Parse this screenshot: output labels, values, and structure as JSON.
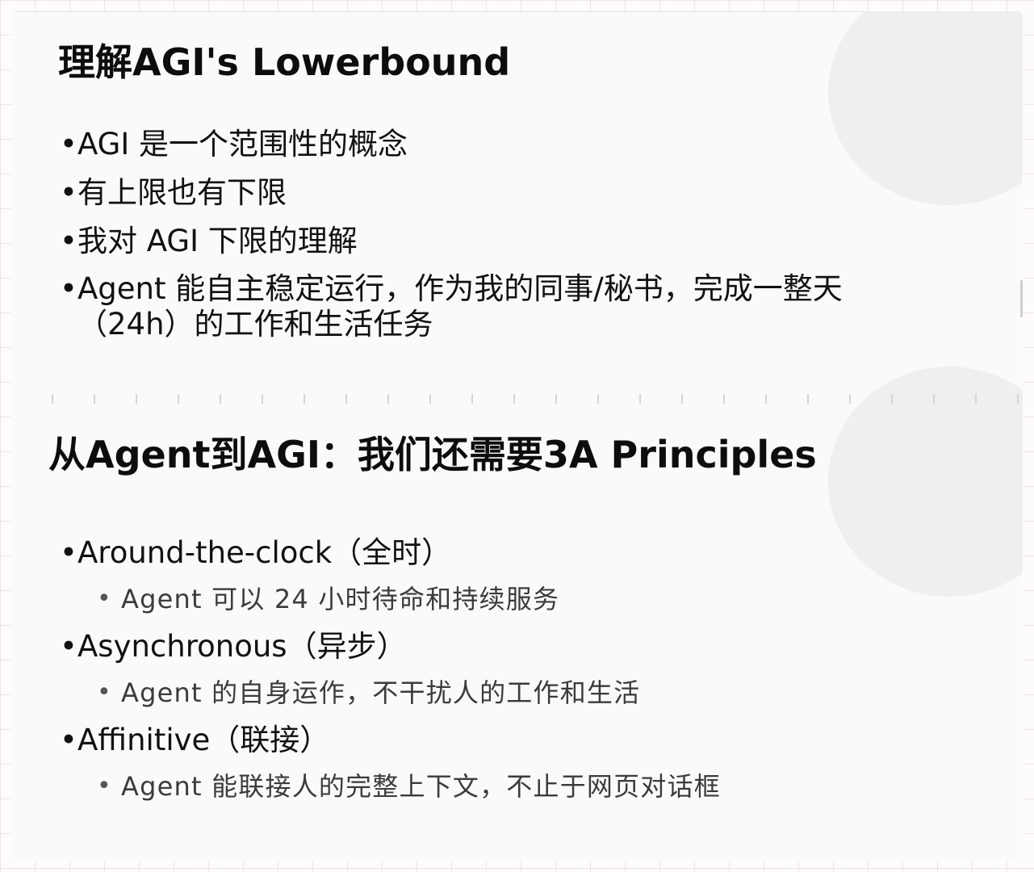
{
  "section1": {
    "title": "理解AGI's Lowerbound",
    "bullets": [
      "AGI 是一个范围性的概念",
      "有上限也有下限",
      "我对 AGI 下限的理解",
      "Agent 能自主稳定运行，作为我的同事/秘书，完成一整天（24h）的工作和生活任务"
    ]
  },
  "section2": {
    "title": "从Agent到AGI：我们还需要3A Principles",
    "principles": [
      {
        "name": "Around-the-clock（全时）",
        "detail": "Agent 可以 24 小时待命和持续服务"
      },
      {
        "name": "Asynchronous（异步）",
        "detail": "Agent 的自身运作，不干扰人的工作和生活"
      },
      {
        "name": "Affinitive（联接）",
        "detail": "Agent 能联接人的完整上下文，不止于网页对话框"
      }
    ]
  },
  "colors": {
    "page_background": "#fdfbfb",
    "sheet_background": "#fafafa",
    "title_text": "#0d0d0d",
    "body_text": "#111111",
    "sub_text": "#3b3b3b",
    "decor_circle": "#efefef"
  }
}
